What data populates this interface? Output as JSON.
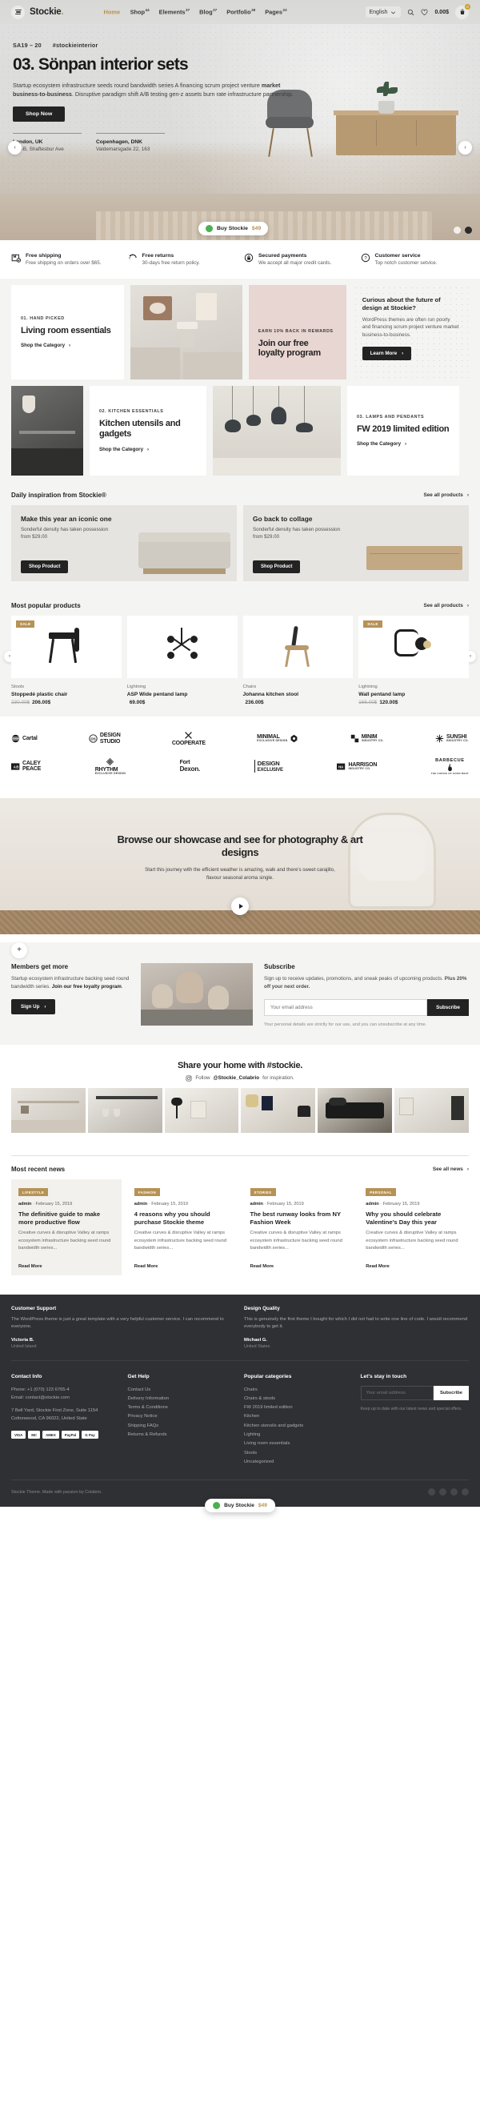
{
  "header": {
    "logo": "Stockie",
    "logo_dot": ".",
    "nav": [
      {
        "label": "Home",
        "sup": ""
      },
      {
        "label": "Shop",
        "sup": "44"
      },
      {
        "label": "Elements",
        "sup": "37"
      },
      {
        "label": "Blog",
        "sup": "27"
      },
      {
        "label": "Portfolio",
        "sup": "28"
      },
      {
        "label": "Pages",
        "sup": "22"
      }
    ],
    "language": "English",
    "cart_total": "0.00$",
    "cart_count": "0"
  },
  "hero": {
    "eyebrow_left": "SA19 – 20",
    "eyebrow_right": "#stockieinterior",
    "title": "03. Sönpan interior sets",
    "paragraph_1": "Startup ecosystem infrastructure seeds round bandwidth series A financing scrum",
    "paragraph_2a": "project venture ",
    "paragraph_2b": "market business-to-business",
    "paragraph_2c": ". Disruptive paradigm shift A/B testing",
    "paragraph_3": "gen-z assets burn rate infrastructure partnership.",
    "cta": "Shop Now",
    "addresses": [
      {
        "city": "London, UK",
        "street": "160-B, Shaftesbur Ave"
      },
      {
        "city": "Copenhagen, DNK",
        "street": "Valdemarsgade 22, 163"
      }
    ],
    "prev": "‹",
    "next": "›",
    "buy_label": "Buy Stockie",
    "buy_amount": "$49"
  },
  "features": [
    {
      "icon": "box-icon",
      "title": "Free shipping",
      "sub": "Free shipping on orders over $65."
    },
    {
      "icon": "return-arrow-icon",
      "title": "Free returns",
      "sub": "30-days free return policy."
    },
    {
      "icon": "lock-icon",
      "title": "Secured payments",
      "sub": "We accept all major credit cards."
    },
    {
      "icon": "question-icon",
      "title": "Customer service",
      "sub": "Top notch customer setvice."
    }
  ],
  "categories": [
    {
      "kicker": "01. HAND PICKED",
      "title": "Living room essentials",
      "link": "Shop the Category"
    },
    {
      "kicker": "02. KITCHEN ESSENTIALS",
      "title": "Kitchen utensils and gadgets",
      "link": "Shop the Category"
    },
    {
      "kicker": "03. LAMPS AND PENDANTS",
      "title": "FW 2019 limited edition",
      "link": "Shop the Category"
    }
  ],
  "loyalty": {
    "kicker": "EARN 10% BACK IN REWARDS",
    "title": "Join our free loyalty program"
  },
  "promo": {
    "title": "Curious about the future of design at Stockie?",
    "body": "WordPress themes are often run poorly and financing scrum project venture market business-to-business.",
    "cta": "Learn More"
  },
  "inspiration": {
    "heading": "Daily inspiration from Stockie®",
    "see_all": "See all products",
    "cards": [
      {
        "title": "Make this year an iconic one",
        "sub": "Sonderful density has taken possession",
        "from": "from $29.00",
        "cta": "Shop Product"
      },
      {
        "title": "Go back to collage",
        "sub": "Sonderful density has taken possession",
        "from": "from $29.00",
        "cta": "Shop Product"
      }
    ]
  },
  "popular": {
    "heading": "Most popular products",
    "see_all": "See all products",
    "products": [
      {
        "sale": "SALE",
        "category": "Stools",
        "name": "Stoppedé plastic chair",
        "old_price": "230.00$",
        "price": "206.00$"
      },
      {
        "sale": "",
        "category": "Lightning",
        "name": "ASP Wide pentand lamp",
        "old_price": "",
        "price": "69.00$"
      },
      {
        "sale": "",
        "category": "Chairs",
        "name": "Johanna kitchen stool",
        "old_price": "",
        "price": "236.00$"
      },
      {
        "sale": "SALE",
        "category": "Lightning",
        "name": "Wall pentand lamp",
        "old_price": "166.00$",
        "price": "120.00$"
      }
    ]
  },
  "brands": {
    "row1": [
      {
        "name": "Cartal",
        "sub": ""
      },
      {
        "name": "DESIGN",
        "sub": "STUDIO",
        "mark": "DS"
      },
      {
        "name": "COOPERATE",
        "sub": ""
      },
      {
        "name": "MINIMAL",
        "sub": "EXCLUSIVE DESIGN"
      },
      {
        "name": "MINIM",
        "sub": "INDUSTRY CO."
      },
      {
        "name": "SUNSHI",
        "sub": "INDUSTRY CO."
      }
    ],
    "row2": [
      {
        "name": "CALEY",
        "sub": "PEACE",
        "mark": "A|B"
      },
      {
        "name": "RHYTHM",
        "sub": "EXCLUSIVE DESIGN"
      },
      {
        "name": "Fort",
        "sub": "Dexon."
      },
      {
        "name": "DESIGN",
        "sub": "EXCLUSIVE"
      },
      {
        "name": "HARRISON",
        "sub": "INDUSTRY CO.",
        "mark": "HA"
      },
      {
        "name": "BARBECUE",
        "sub": "THE CHOICE OF GOOD MEAT"
      }
    ]
  },
  "showcase": {
    "title": "Browse our showcase and see for photography & art designs",
    "body": "Start this journey with the efficient weather is amazing, walk and there's sweet carajillo, flavour seasonal aroma single."
  },
  "members": {
    "plus": "+",
    "title": "Members get more",
    "body_a": "Startup ecosystem infrastructure backing seed round bandwidth series. ",
    "body_b": "Join our free loyalty program",
    "body_c": ".",
    "cta": "Sign Up"
  },
  "subscribe": {
    "title": "Subscribe",
    "body_a": "Sign up to receive updates, promotions, and sneak peaks of upcoming products. ",
    "body_b": "Plus 20% off your next order.",
    "placeholder": "Your email address",
    "button": "Subscribe",
    "note": "Your personal details are strictly for our use, and you can unsubscribe at any time."
  },
  "instagram": {
    "title": "Share your home with #stockie.",
    "follow_pre": "Follow ",
    "handle": "@Stockie_Colabrio",
    "follow_post": " for inspiration."
  },
  "news": {
    "heading": "Most recent news",
    "see_all": "See all news",
    "posts": [
      {
        "tag": "LIFESTYLE",
        "author": "admin",
        "date": "February 15, 2019",
        "title": "The definitive guide to make more productive flow",
        "excerpt": "Creative curves & disruptive Valley at ramps ecosystem infrastructure backing seed round bandwidth series...",
        "read": "Read More"
      },
      {
        "tag": "FASHION",
        "author": "admin",
        "date": "February 15, 2019",
        "title": "4 reasons why you should purchase Stockie theme",
        "excerpt": "Creative curves & disruptive Valley at ramps ecosystem infrastructure backing seed round bandwidth series...",
        "read": "Read More"
      },
      {
        "tag": "STORIES",
        "author": "admin",
        "date": "February 15, 2019",
        "title": "The best runway looks from NY Fashion Week",
        "excerpt": "Creative curves & disruptive Valley at ramps ecosystem infrastructure backing seed round bandwidth series...",
        "read": "Read More"
      },
      {
        "tag": "PERSONAL",
        "author": "admin",
        "date": "February 15, 2019",
        "title": "Why you should celebrate Valentine's Day this year",
        "excerpt": "Creative curves & disruptive Valley at ramps ecosystem infrastructure backing seed round bandwidth series...",
        "read": "Read More"
      }
    ]
  },
  "footer": {
    "testimonials": [
      {
        "heading": "Customer Support",
        "body": "The WordPress theme is just a great template with a very helpful customer service. I can recommend to everyone.",
        "who": "Victoria B.",
        "where": "United Island"
      },
      {
        "heading": "Design Quality",
        "body": "This is genuinely the first theme I bought for which I did not had to write one line of code. I would recommend everybody to get it.",
        "who": "Michael G.",
        "where": "United States"
      }
    ],
    "contact": {
      "title": "Contact Info",
      "lines": [
        "Phone: +1 (070) 123 6765-4",
        "Email: contact@stockie.com",
        "7 Bell Yard, Stockie First Zone, Suite 1154",
        "Cottonwood, CA 96022, United State"
      ]
    },
    "help": {
      "title": "Get Help",
      "items": [
        "Contact Us",
        "Delivery Information",
        "Terms & Conditions",
        "Privacy Notice",
        "Shipping FAQs",
        "Returns & Refunds"
      ]
    },
    "popular": {
      "title": "Popular categories",
      "items": [
        "Chairs",
        "Chairs & stools",
        "FW 2019 limited edition",
        "Kitchen",
        "Kitchen utensils and gadgets",
        "Lighting",
        "Living room essentials",
        "Stools",
        "Uncategorized"
      ]
    },
    "touch": {
      "title": "Let's stay in touch",
      "placeholder": "Your email address",
      "button": "Subscribe",
      "note": "Keep up to date with our latest news and special offers."
    },
    "payments": [
      "VISA",
      "MC",
      "AMEX",
      "PayPal",
      "G Pay"
    ],
    "copyright": "Stockie Theme. Made with passion by Colabrio.",
    "buy_label": "Buy Stockie",
    "buy_amount": "$49"
  }
}
